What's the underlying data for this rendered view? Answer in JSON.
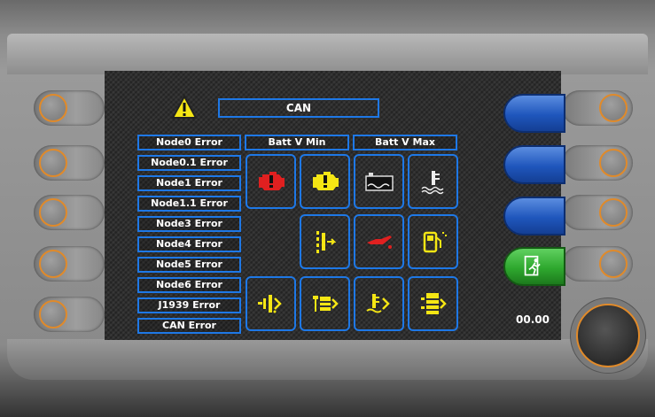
{
  "header": {
    "status_title": "CAN"
  },
  "error_labels": [
    "Node0 Error",
    "Node0.1 Error",
    "Node1 Error",
    "Node1.1 Error",
    "Node3 Error",
    "Node4 Error",
    "Node5 Error",
    "Node6 Error",
    "J1939 Error",
    "CAN Error"
  ],
  "columns": {
    "batt_min": "Batt V Min",
    "batt_max": "Batt V Max"
  },
  "icons": {
    "row1": [
      "engine-fault-red-icon",
      "engine-fault-yellow-icon",
      "battery-level-icon",
      "coolant-temp-icon"
    ],
    "row2": [
      "transmission-filter-icon",
      "oil-pressure-icon",
      "fuel-level-icon"
    ],
    "row3": [
      "fluid-filter-icon",
      "service-filter-icon",
      "transmission-temp-icon",
      "hydraulic-filter-icon"
    ]
  },
  "softkeys": [
    "softkey-1",
    "softkey-2",
    "softkey-3",
    "exit"
  ],
  "readout": "00.00",
  "colors": {
    "accent": "#1e78e6",
    "alert_red": "#e02020",
    "alert_yellow": "#f5e614",
    "knob_ring": "#e08a2a",
    "exit_green": "#2ea82e"
  }
}
